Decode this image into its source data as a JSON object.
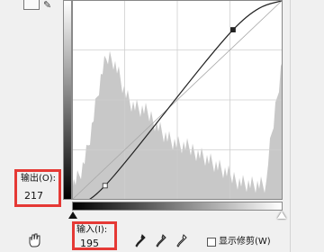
{
  "curves": {
    "output_label": "输出(O):",
    "output_value": "217",
    "input_label": "输入(I):",
    "input_value": "195",
    "show_clipping_label": "显示修剪(W)",
    "show_clipping_checked": false,
    "curve_points": [
      [
        0,
        0
      ],
      [
        40,
        18
      ],
      [
        195,
        217
      ],
      [
        255,
        255
      ]
    ],
    "icons": {
      "top_curve_tool": "curve-edit-icon",
      "top_pencil": "pencil-icon",
      "hand": "targeted-adjustment-icon",
      "eyedroppers": [
        "black-point-eyedropper-icon",
        "gray-point-eyedropper-icon",
        "white-point-eyedropper-icon"
      ]
    },
    "colors": {
      "highlight": "#e53935",
      "histogram": "#c8c8c8",
      "grid": "#cfcfcf",
      "curve": "#222222"
    }
  }
}
